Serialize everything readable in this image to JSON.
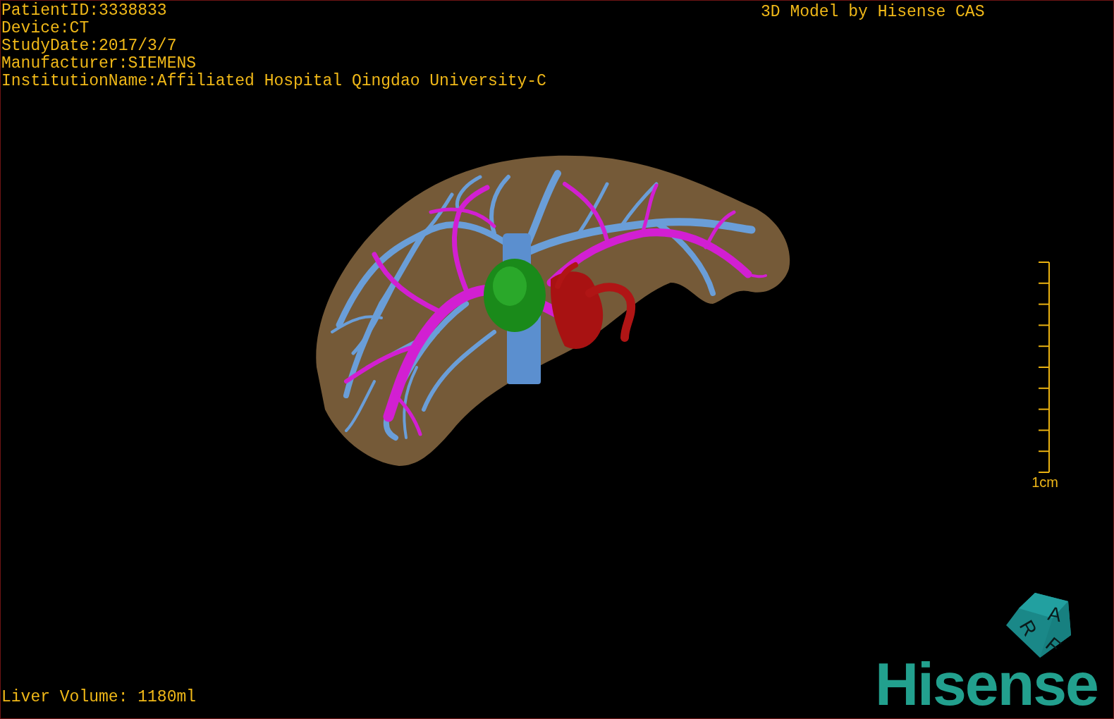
{
  "study_info": [
    "PatientID:3338833",
    "Device:CT",
    "StudyDate:2017/3/7",
    "Manufacturer:SIEMENS",
    "InstitutionName:Affiliated Hospital Qingdao University-C"
  ],
  "title": "3D Model by Hisense CAS",
  "scale_bar": {
    "label": "1cm"
  },
  "liver_volume": "Liver Volume: 1180ml",
  "orientation_cube": {
    "labels": [
      "R",
      "A",
      "F"
    ]
  },
  "logo": "Hisense"
}
